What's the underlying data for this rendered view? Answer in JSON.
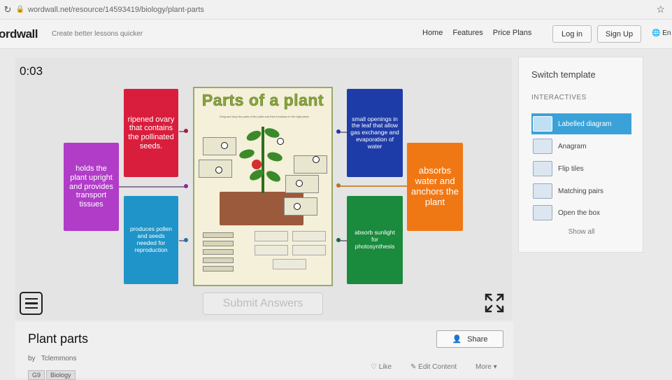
{
  "browser": {
    "url": "wordwall.net/resource/14593419/biology/plant-parts"
  },
  "nav": {
    "logo": "ordwall",
    "tagline": "Create better lessons quicker",
    "links": [
      "Home",
      "Features",
      "Price Plans"
    ],
    "login": "Log in",
    "signup": "Sign Up",
    "lang": "En"
  },
  "game": {
    "timer": "0:03",
    "poster_title": "Parts of a plant",
    "poster_subtitle": "Drag and drop the parts of the plant and their functions to the right place",
    "cards": {
      "ovary": "ripened ovary that contains the pollinated seeds.",
      "stem": "holds the plant upright and provides transport tissues",
      "flower": "produces pollen and seeds needed for reproduction",
      "stomata": "small openings in the leaf that allow gas exchange and evaporation of water",
      "roots": "absorbs water and anchors the plant",
      "leaf": "absorb sunlight for photosynthesis"
    },
    "submit": "Submit Answers"
  },
  "sidebar": {
    "title": "Switch template",
    "section": "INTERACTIVES",
    "templates": [
      "Labelled diagram",
      "Anagram",
      "Flip tiles",
      "Matching pairs",
      "Open the box"
    ],
    "show_all": "Show all"
  },
  "activity": {
    "title": "Plant parts",
    "by_label": "by",
    "author": "Tclemmons",
    "share": "Share",
    "like": "Like",
    "edit": "Edit Content",
    "more": "More",
    "tags": [
      "G9",
      "Biology"
    ]
  },
  "colors": {
    "ovary": "#d81e3c",
    "stem": "#b03cc8",
    "flower": "#1f94c8",
    "stomata": "#1e3ca8",
    "roots": "#f07814",
    "leaf": "#1a8a3c",
    "template_active": "#3aa2d8"
  }
}
